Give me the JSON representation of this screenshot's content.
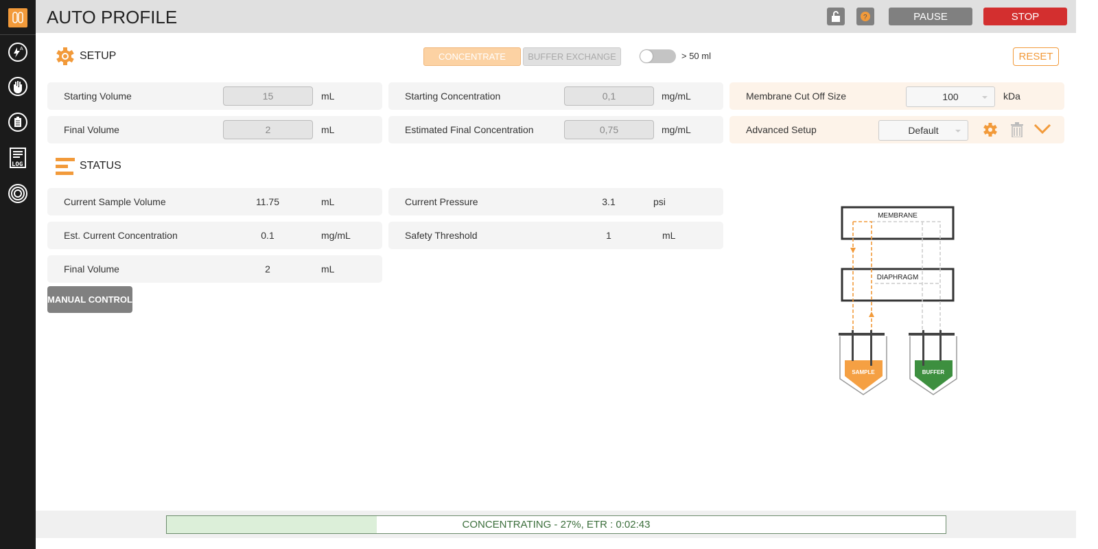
{
  "header": {
    "title": "AUTO PROFILE",
    "pause_label": "PAUSE",
    "stop_label": "STOP"
  },
  "sidebar": {
    "items": [
      {
        "icon": "auto-flash-icon"
      },
      {
        "icon": "hand-icon"
      },
      {
        "icon": "clipboard-icon"
      },
      {
        "icon": "log-icon",
        "label": "LOG"
      },
      {
        "icon": "lifebuoy-icon"
      }
    ]
  },
  "setup": {
    "title": "SETUP",
    "mode_concentrate": "CONCENTRATE",
    "mode_buffer": "BUFFER EXCHANGE",
    "toggle_label": "> 50 ml",
    "toggle_on": false,
    "reset_label": "RESET",
    "starting_volume": {
      "label": "Starting Volume",
      "value": "15",
      "unit": "mL"
    },
    "final_volume": {
      "label": "Final Volume",
      "value": "2",
      "unit": "mL"
    },
    "starting_concentration": {
      "label": "Starting Concentration",
      "value": "0,1",
      "unit": "mg/mL"
    },
    "est_final_concentration": {
      "label": "Estimated Final Concentration",
      "value": "0,75",
      "unit": "mg/mL"
    },
    "membrane_cutoff": {
      "label": "Membrane Cut Off Size",
      "value": "100",
      "unit": "kDa"
    },
    "advanced": {
      "label": "Advanced Setup",
      "value": "Default"
    }
  },
  "status": {
    "title": "STATUS",
    "current_sample_volume": {
      "label": "Current Sample Volume",
      "value": "11.75",
      "unit": "mL"
    },
    "est_current_concentration": {
      "label": "Est. Current Concentration",
      "value": "0.1",
      "unit": "mg/mL"
    },
    "final_volume": {
      "label": "Final Volume",
      "value": "2",
      "unit": "mL"
    },
    "current_pressure": {
      "label": "Current Pressure",
      "value": "3.1",
      "unit": "psi"
    },
    "safety_threshold": {
      "label": "Safety Threshold",
      "value": "1",
      "unit": "mL"
    },
    "manual_control_label": "MANUAL CONTROL"
  },
  "diagram": {
    "membrane": "MEMBRANE",
    "diaphragm": "DIAPHRAGM",
    "sample": "SAMPLE",
    "buffer": "BUFFER"
  },
  "progress": {
    "text": "CONCENTRATING - 27%, ETR : 0:02:43",
    "percent": 27
  },
  "colors": {
    "accent": "#f29a3a",
    "stop": "#d32f2f",
    "buffer": "#3d8f3f",
    "progress_fill": "#dcefd9"
  }
}
